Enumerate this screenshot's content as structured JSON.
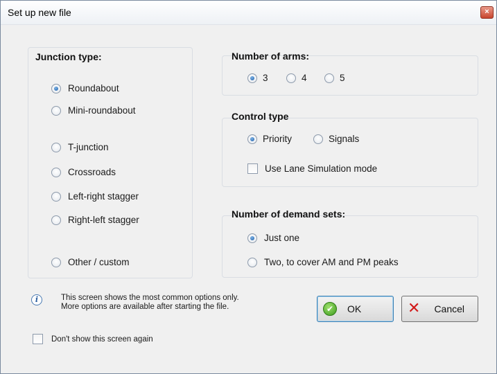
{
  "window": {
    "title": "Set up new file",
    "close_glyph": "×"
  },
  "junction_type": {
    "title": "Junction type:",
    "options": [
      {
        "label": "Roundabout",
        "checked": true
      },
      {
        "label": "Mini-roundabout",
        "checked": false
      },
      {
        "label": "T-junction",
        "checked": false
      },
      {
        "label": "Crossroads",
        "checked": false
      },
      {
        "label": "Left-right stagger",
        "checked": false
      },
      {
        "label": "Right-left stagger",
        "checked": false
      },
      {
        "label": "Other / custom",
        "checked": false
      }
    ]
  },
  "number_of_arms": {
    "title": "Number of arms:",
    "options": [
      {
        "label": "3",
        "checked": true
      },
      {
        "label": "4",
        "checked": false
      },
      {
        "label": "5",
        "checked": false
      }
    ]
  },
  "control_type": {
    "title": "Control type",
    "options": [
      {
        "label": "Priority",
        "checked": true
      },
      {
        "label": "Signals",
        "checked": false
      }
    ],
    "lane_sim_label": "Use Lane Simulation mode",
    "lane_sim_checked": false
  },
  "demand_sets": {
    "title": "Number of demand sets:",
    "options": [
      {
        "label": "Just one",
        "checked": true
      },
      {
        "label": "Two, to cover AM and PM peaks",
        "checked": false
      }
    ]
  },
  "info": {
    "line1": "This screen shows the most common options only.",
    "line2": "More options are available after starting the file."
  },
  "buttons": {
    "ok_label": "OK",
    "cancel_label": "Cancel"
  },
  "dont_show": {
    "label": "Don't show this screen again",
    "checked": false
  },
  "icons": {
    "info": "info-icon",
    "ok": "ok-check-icon",
    "cancel": "cancel-x-icon",
    "close": "close-icon"
  },
  "colors": {
    "radio_selected": "#1a5ba8",
    "ok_green": "#3c9a1d",
    "cancel_red": "#d11919",
    "default_button_border": "#3c7fb1"
  }
}
